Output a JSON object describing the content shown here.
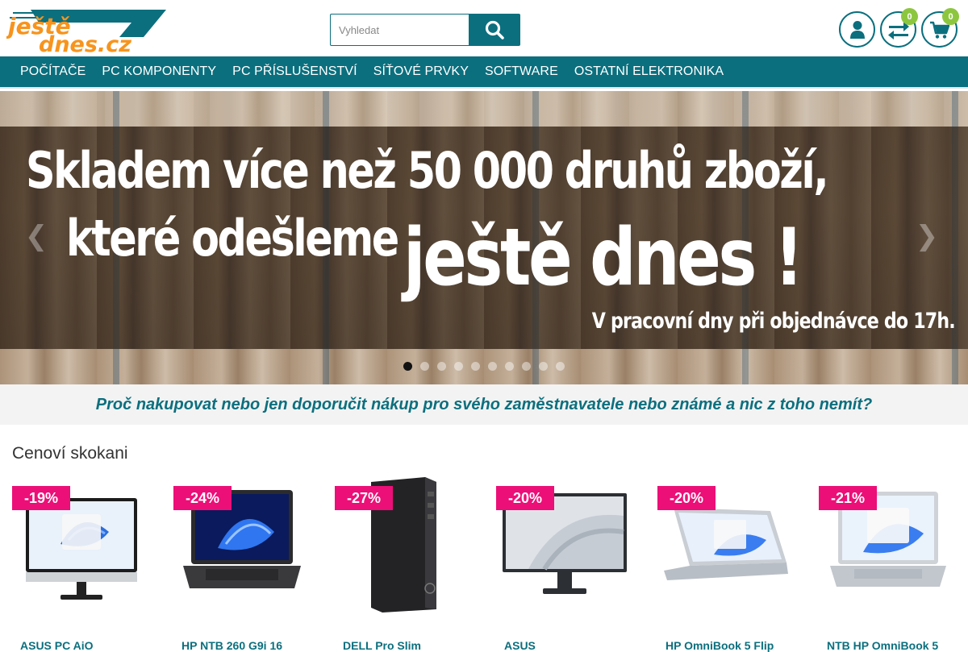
{
  "header": {
    "logo_text_line1": "ještě",
    "logo_text_line2": "dnes.cz",
    "search_placeholder": "Vyhledat",
    "compare_count": "0",
    "cart_count": "0",
    "accent_color": "#0b6f7e",
    "badge_color": "#8cc63f"
  },
  "nav": {
    "items": [
      "POČÍTAČE",
      "PC KOMPONENTY",
      "PC PŘÍSLUŠENSTVÍ",
      "SÍŤOVÉ PRVKY",
      "SOFTWARE",
      "OSTATNÍ ELEKTRONIKA"
    ]
  },
  "banner": {
    "line1": "Skladem více než 50 000 druhů zboží,",
    "line2": "které odešleme",
    "line3": "ještě dnes !",
    "line4": "V pracovní dny při objednávce do 17h.",
    "slides_total": 10,
    "active_slide": 1
  },
  "promo": {
    "text": "Proč nakupovat nebo jen doporučit nákup pro svého zaměstnavatele nebo známé a nic z toho nemít?"
  },
  "products": {
    "title": "Cenoví skokani",
    "discount_color": "#ec0f77",
    "items": [
      {
        "discount": "-19%",
        "name": "ASUS PC AiO",
        "image": "all-in-one-pc"
      },
      {
        "discount": "-24%",
        "name": "HP NTB 260 G9i 16",
        "image": "laptop-dark"
      },
      {
        "discount": "-27%",
        "name": "DELL Pro Slim",
        "image": "tower-pc"
      },
      {
        "discount": "-20%",
        "name": "ASUS",
        "image": "monitor"
      },
      {
        "discount": "-20%",
        "name": "HP OmniBook 5 Flip",
        "image": "convertible-laptop"
      },
      {
        "discount": "-21%",
        "name": "NTB HP OmniBook 5",
        "image": "laptop-silver"
      }
    ]
  }
}
